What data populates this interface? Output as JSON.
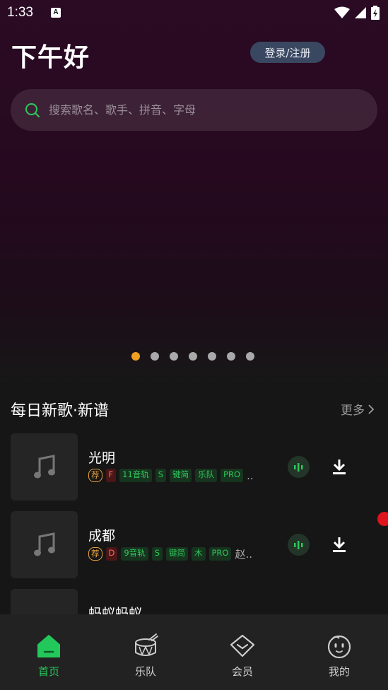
{
  "status_bar": {
    "time": "1:33",
    "notification_icon": "A"
  },
  "header": {
    "greeting": "下午好",
    "login_label": "登录/注册"
  },
  "search": {
    "placeholder": "搜索歌名、歌手、拼音、字母"
  },
  "carousel": {
    "dot_count": 7,
    "active_index": 0
  },
  "section": {
    "title": "每日新歌·新谱",
    "more_label": "更多"
  },
  "songs": [
    {
      "title": "光明",
      "tags": [
        "荐",
        "F",
        "11音轨",
        "S",
        "键简",
        "乐队",
        "PRO"
      ],
      "extra": ".."
    },
    {
      "title": "成都",
      "tags": [
        "荐",
        "D",
        "9音轨",
        "S",
        "键简",
        "木",
        "PRO"
      ],
      "extra": "赵.."
    },
    {
      "title": "蚂蚁蚂蚁",
      "tags": [],
      "extra": ""
    }
  ],
  "bottom_nav": [
    {
      "label": "首页",
      "icon": "home-icon",
      "active": true
    },
    {
      "label": "乐队",
      "icon": "drum-icon",
      "active": false
    },
    {
      "label": "会员",
      "icon": "diamond-icon",
      "active": false
    },
    {
      "label": "我的",
      "icon": "profile-face-icon",
      "active": false
    }
  ],
  "colors": {
    "accent_green": "#23c85a",
    "active_dot": "#f0a020",
    "notification": "#e0141c"
  }
}
